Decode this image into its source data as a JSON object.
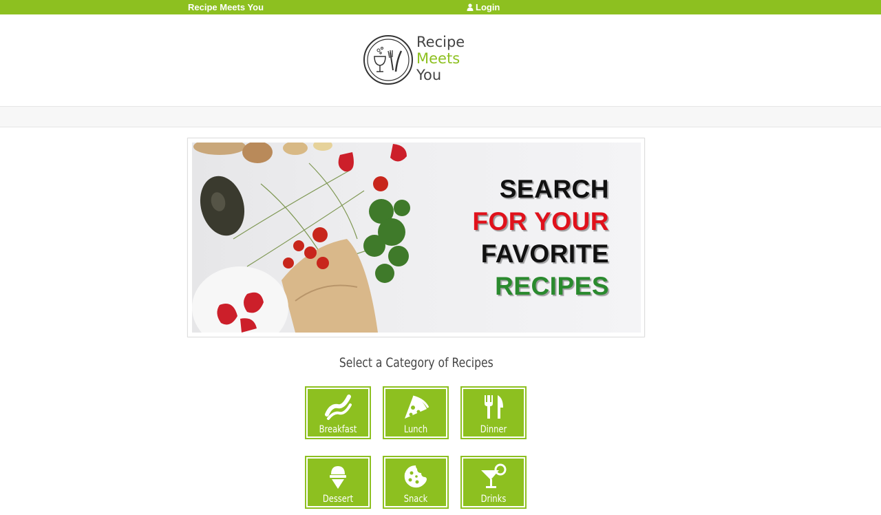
{
  "topbar": {
    "site_name": "Recipe Meets You",
    "login_label": "Login",
    "login_icon": "user-icon"
  },
  "logo": {
    "line1": "Recipe",
    "line2": "Meets",
    "line3": "You",
    "icon": "dining-circle-icon"
  },
  "banner": {
    "line1": "SEARCH",
    "line2": "FOR YOUR",
    "line3": "FAVORITE",
    "line4": "RECIPES"
  },
  "categories": {
    "title": "Select a Category of Recipes",
    "items": [
      {
        "label": "Breakfast",
        "icon": "bacon-icon"
      },
      {
        "label": "Lunch",
        "icon": "pizza-icon"
      },
      {
        "label": "Dinner",
        "icon": "utensils-icon"
      },
      {
        "label": "Dessert",
        "icon": "ice-cream-icon"
      },
      {
        "label": "Snack",
        "icon": "cookie-icon"
      },
      {
        "label": "Drinks",
        "icon": "cocktail-icon"
      }
    ]
  },
  "colors": {
    "brand_green": "#8dc020",
    "headline_red": "#e0111b",
    "headline_green": "#2a8a2e"
  }
}
